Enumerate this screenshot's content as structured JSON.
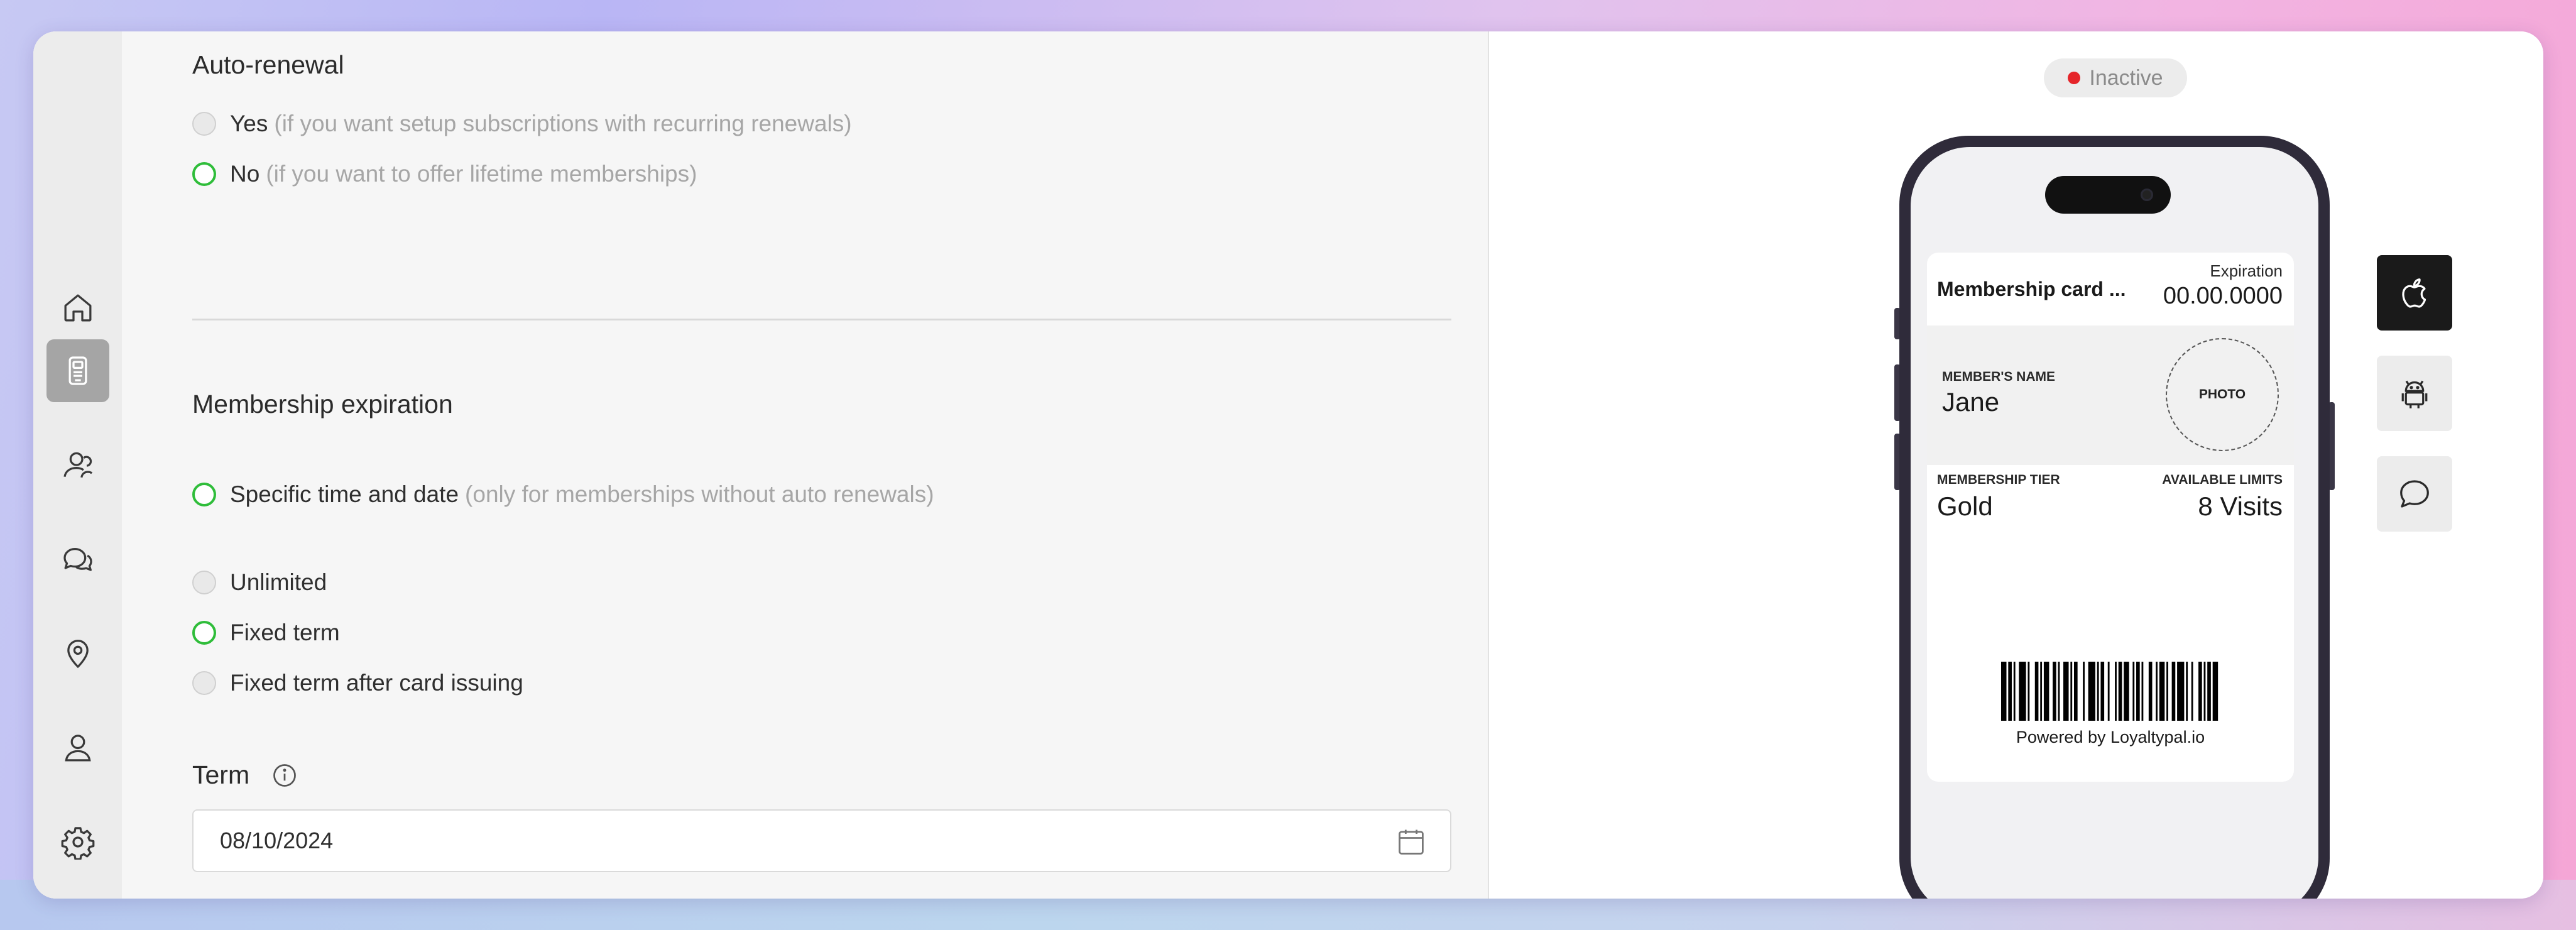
{
  "auto_renewal": {
    "title": "Auto-renewal",
    "options": [
      {
        "label": "Yes",
        "hint": "(if you want setup subscriptions with recurring renewals)",
        "selected": false
      },
      {
        "label": "No",
        "hint": "(if you want to offer lifetime memberships)",
        "selected": true
      }
    ]
  },
  "expiration": {
    "title": "Membership expiration",
    "specific": {
      "label": "Specific time and date",
      "hint": "(only for memberships without auto renewals)",
      "selected": true
    },
    "options": [
      {
        "label": "Unlimited",
        "selected": false
      },
      {
        "label": "Fixed term",
        "selected": true
      },
      {
        "label": "Fixed term after card issuing",
        "selected": false
      }
    ]
  },
  "term": {
    "label": "Term",
    "value": "08/10/2024"
  },
  "status": {
    "label": "Inactive",
    "color": "#e5252a"
  },
  "card": {
    "name": "Membership card ...",
    "expiration_label": "Expiration",
    "expiration_value": "00.00.0000",
    "member_name_label": "MEMBER'S NAME",
    "member_name": "Jane",
    "photo_label": "PHOTO",
    "tier_label": "MEMBERSHIP TIER",
    "tier_value": "Gold",
    "limits_label": "AVAILABLE LIMITS",
    "limits_value": "8 Visits",
    "powered_by": "Powered by Loyaltypal.io"
  },
  "sidebar": {
    "items": [
      {
        "icon": "home-icon",
        "active": false
      },
      {
        "icon": "wallet-card-icon",
        "active": true
      },
      {
        "icon": "users-icon",
        "active": false
      },
      {
        "icon": "chat-icon",
        "active": false
      },
      {
        "icon": "location-icon",
        "active": false
      },
      {
        "icon": "user-icon",
        "active": false
      },
      {
        "icon": "gear-icon",
        "active": false
      }
    ]
  },
  "preview_platforms": [
    {
      "icon": "apple-icon",
      "active": true
    },
    {
      "icon": "android-icon",
      "active": false
    },
    {
      "icon": "message-icon",
      "active": false
    }
  ],
  "colors": {
    "accent_green": "#2fbd3a",
    "active_nav": "#a5a5a5"
  }
}
